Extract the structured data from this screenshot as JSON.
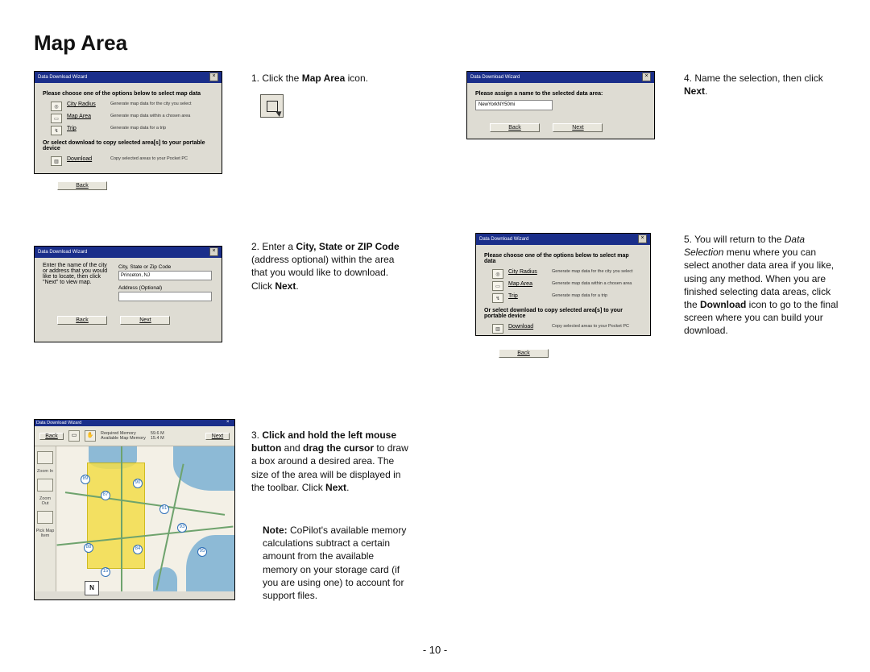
{
  "title": "Map Area",
  "page_number": "- 10 -",
  "steps": {
    "1": {
      "prefix": "1. ",
      "pre": "Click the ",
      "bold": "Map Area",
      "post": " icon."
    },
    "2": {
      "prefix": "2. ",
      "pre": "Enter a ",
      "bold": "City, State or ZIP Code",
      "mid": " (address optional) within the area that you would like to download.  Click ",
      "bold2": "Next",
      "post": "."
    },
    "3a": {
      "prefix": "3. ",
      "b1": "Click and hold the left mouse button",
      "mid1": " and ",
      "b2": "drag the cursor",
      "mid2": " to draw a box around a desired area.  The size of the area will be displayed in the toolbar. Click ",
      "b3": "Next",
      "post": "."
    },
    "3note": {
      "b": "Note:",
      "text": "  CoPilot's available memory calculations subtract a certain amount from the available memory on your storage card (if you are using one) to account for support files."
    },
    "4": {
      "prefix": "4. ",
      "pre": "Name the selection, then click ",
      "bold": "Next",
      "post": "."
    },
    "5": {
      "prefix": "5. ",
      "pre": "You will return to the ",
      "it1": "Data Selection",
      "mid": " menu where you can select another data area if you like, using any method.  When you are finished selecting data areas, click the ",
      "bold": "Download",
      "post": " icon to go to the final screen where you can build your download."
    }
  },
  "wizard": {
    "title": "Data Download Wizard",
    "select_header": "Please choose one of the options below to select map data",
    "copy_header": "Or select download to copy selected area[s] to your portable device",
    "name_header": "Please assign a name to the selected data area:",
    "name_value": "NewYorkNY50mi",
    "addr_header": "Enter the name of the city or address that you would like to locate, then click \"Next\" to view map.",
    "addr_label1": "City, State or Zip Code",
    "addr_value1": "Princeton, NJ",
    "addr_label2": "Address (Optional)",
    "opts": {
      "city_radius": {
        "label": "City Radius",
        "desc": "Generate map data for the city you select"
      },
      "map_area": {
        "label": "Map Area",
        "desc": "Generate map data within a chosen area"
      },
      "trip": {
        "label": "Trip",
        "desc": "Generate map data for a trip"
      },
      "download": {
        "label": "Download",
        "desc": "Copy selected areas to your Pocket PC"
      }
    },
    "btn_back": "Back",
    "btn_next": "Next"
  },
  "mapwiz": {
    "title": "Data Download Wizard",
    "tool_back": "Back",
    "tool_next": "Next",
    "mem1": "Required Memory",
    "mem2": "Available Map Memory",
    "mem1v": "59.6 M",
    "mem2v": "15.4 M",
    "side": [
      "Zoom In",
      "Zoom Out",
      "Pick Map Item"
    ],
    "compass": "N",
    "badges": [
      "89",
      "87",
      "90",
      "91",
      "88",
      "84",
      "93",
      "95",
      "15"
    ]
  }
}
